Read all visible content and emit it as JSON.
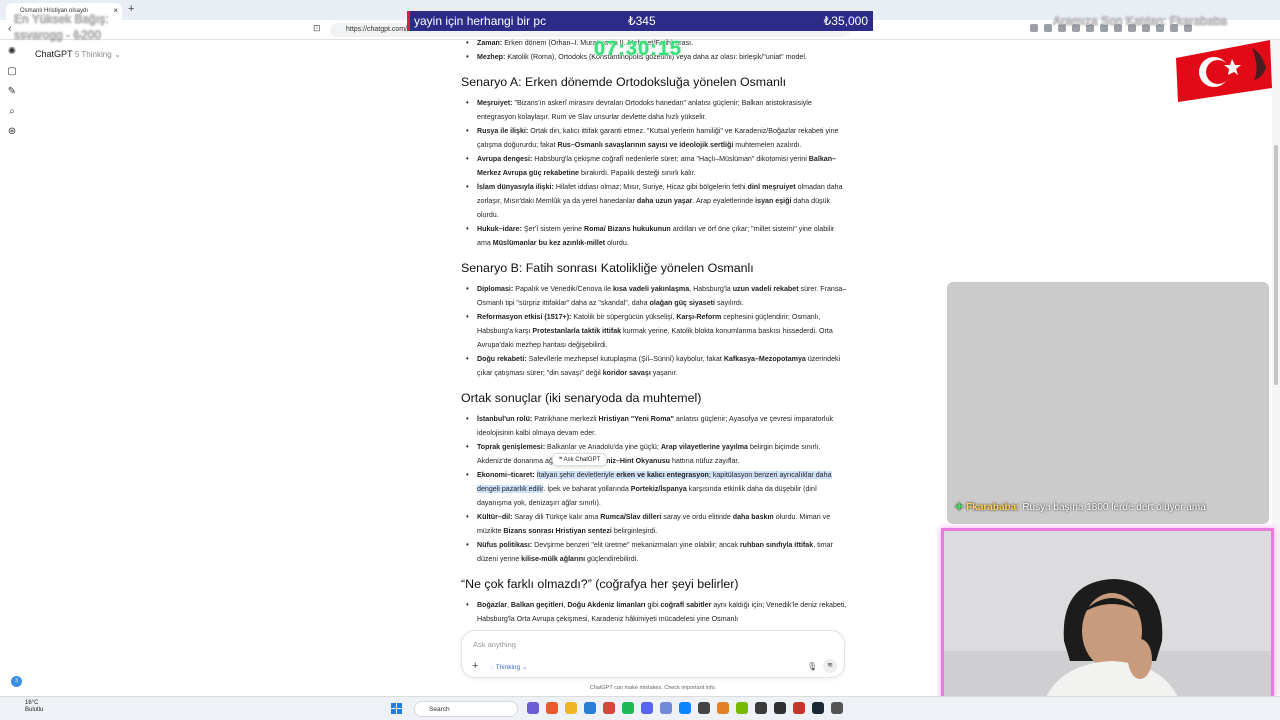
{
  "browser": {
    "tab_title": "Osmanlı Hristiyan olsaydı",
    "tab_close": "×",
    "new_tab": "+",
    "url": "https://chatgpt.com/c/6820f375-07fc-8010-8120-5553bb3bc550"
  },
  "app": {
    "model_name": "ChatGPT",
    "model_suffix": "5 Thinking"
  },
  "content": {
    "top_lines": [
      {
        "b": "Zaman:",
        "t": " Erken dönem (Orhan–I. Murat ya da II. Mehmet/Fatih) arası."
      },
      {
        "b": "Mezhep:",
        "t": " Katolik (Roma), Ortodoks (Konstantinopolis gözetimi) veya daha az olası: birleşik/\"uniat\" model."
      }
    ],
    "sections": [
      {
        "title": "Senaryo A: Erken dönemde Ortodoksluğa yönelen Osmanlı",
        "items": [
          [
            {
              "b": "Meşruiyet:"
            },
            {
              "t": " \"Bizans'ın askerî mirasını devralan Ortodoks hanedan\" anlatısı güçlenir; Balkan aristokrasisiyle entegrasyon kolaylaşır. Rum ve Slav unsurlar devlette daha hızlı yükselir."
            }
          ],
          [
            {
              "b": "Rusya ile ilişki:"
            },
            {
              "t": " Ortak din, kalıcı ittifak garanti etmez. \"Kutsal yerlerin hamiliği\" ve Karadeniz/Boğazlar rekabeti yine çatışma doğururdu; fakat "
            },
            {
              "b": "Rus–Osmanlı savaşlarının sayısı ve ideolojik sertliği"
            },
            {
              "t": " muhtemelen azalırdı."
            }
          ],
          [
            {
              "b": "Avrupa dengesi:"
            },
            {
              "t": " Habsburg'la çekişme coğrafî nedenlerle sürer; ama \"Haçlı–Müslüman\" dikotomisi yerini "
            },
            {
              "b": "Balkan–Merkez Avrupa güç rekabetine"
            },
            {
              "t": " bırakırdı. Papalık desteği sınırlı kalır."
            }
          ],
          [
            {
              "b": "İslam dünyasıyla ilişki:"
            },
            {
              "t": " Hilafet iddiası olmaz; Mısır, Suriye, Hicaz gibi bölgelerin fethi "
            },
            {
              "b": "dinî meşruiyet"
            },
            {
              "t": " olmadan daha zorlaşır, Mısır'daki Memlûk ya da yerel hanedanlar "
            },
            {
              "b": "daha uzun yaşar"
            },
            {
              "t": ". Arap eyaletlerinde "
            },
            {
              "b": "isyan eşiği"
            },
            {
              "t": " daha düşük olurdu."
            }
          ],
          [
            {
              "b": "Hukuk–idare:"
            },
            {
              "t": " Şer'î sistem yerine "
            },
            {
              "b": "Roma/ Bizans hukukunun"
            },
            {
              "t": " ardılları ve örf öne çıkar; \"millet sistemi\" yine olabilir ama "
            },
            {
              "b": "Müslümanlar bu kez azınlık-millet"
            },
            {
              "t": " olurdu."
            }
          ]
        ]
      },
      {
        "title": "Senaryo B: Fatih sonrası Katolikliğe yönelen Osmanlı",
        "items": [
          [
            {
              "b": "Diplomasi:"
            },
            {
              "t": " Papalık ve Venedik/Cenova ile "
            },
            {
              "b": "kısa vadeli yakınlaşma"
            },
            {
              "t": ", Habsburg'la "
            },
            {
              "b": "uzun vadeli rekabet"
            },
            {
              "t": " sürer. Fransa–Osmanlı tipi \"sürpriz ittifaklar\" daha az \"skandal\", daha "
            },
            {
              "b": "olağan güç siyaseti"
            },
            {
              "t": " sayılırdı."
            }
          ],
          [
            {
              "b": "Reformasyon etkisi (1517+):"
            },
            {
              "t": " Katolik bir süpergücün yükselişi, "
            },
            {
              "b": "Karşı-Reform"
            },
            {
              "t": " cephesini güçlendirir; Osmanlı, Habsburg'a karşı "
            },
            {
              "b": "Protestanlarla taktik ittifak"
            },
            {
              "t": " kurmak yerine, Katolik blokta konumlanma baskısı hissederdi. Orta Avrupa'daki mezhep haritası değişebilirdi."
            }
          ],
          [
            {
              "b": "Doğu rekabeti:"
            },
            {
              "t": " Safevîlerle mezhepsel kutuplaşma (Şiî–Sünnî) kaybolur, fakat "
            },
            {
              "b": "Kafkasya–Mezopotamya"
            },
            {
              "t": " üzerindeki çıkar çatışması sürer; \"din savaşı\" değil "
            },
            {
              "b": "koridor savaşı"
            },
            {
              "t": " yaşanır."
            }
          ]
        ]
      },
      {
        "title": "Ortak sonuçlar (iki senaryoda da muhtemel)",
        "items": [
          [
            {
              "b": "İstanbul'un rolü:"
            },
            {
              "t": " Patrikhane merkezli "
            },
            {
              "b": "Hristiyan \"Yeni Roma\""
            },
            {
              "t": " anlatısı güçlenir; Ayasofya ve çevresi imparatorluk ideolojisinin kalbi olmaya devam eder."
            }
          ],
          [
            {
              "b": "Toprak genişlemesi:"
            },
            {
              "t": " Balkanlar ve Anadolu'da yine güçlü; "
            },
            {
              "b": "Arap vilayetlerine yayılma"
            },
            {
              "t": " belirgin biçimde sınırlı. Akdeniz'de donanma ağırlığı sürer; "
            },
            {
              "b": "Akdeniz–Hint Okyanusu"
            },
            {
              "t": " hattına nüfuz zayıflar."
            }
          ],
          [
            {
              "b": "Ekonomi–ticaret:"
            },
            {
              "t": " "
            },
            {
              "h": "İtalyan şehir devletleriyle "
            },
            {
              "hb": "erken ve kalıcı entegrasyon"
            },
            {
              "h": "; kapitülasyon benzeri ayrıcalıklar daha dengeli pazarlık edilir"
            },
            {
              "t": ". İpek ve baharat yollarında "
            },
            {
              "b": "Portekiz/İspanya"
            },
            {
              "t": " karşısında etkinlik daha da düşebilir (dinî dayanışma yok, denizaşırı ağlar sınırlı)."
            }
          ],
          [
            {
              "b": "Kültür–dil:"
            },
            {
              "t": " Saray dili Türkçe kalır ama "
            },
            {
              "b": "Rumca/Slav dilleri"
            },
            {
              "t": " saray ve ordu elitinde "
            },
            {
              "b": "daha baskın"
            },
            {
              "t": " olurdu. Mimari ve müzikte "
            },
            {
              "b": "Bizans sonrası Hristiyan sentezi"
            },
            {
              "t": " belirginleşirdi."
            }
          ],
          [
            {
              "b": "Nüfus politikası:"
            },
            {
              "t": " Devşirme benzeri \"elit üretme\" mekanizmaları yine olabilir; ancak "
            },
            {
              "b": "ruhban sınıfıyla ittifak"
            },
            {
              "t": ", timar düzeni yerine "
            },
            {
              "b": "kilise-mülk ağlarını"
            },
            {
              "t": " güçlendirebilirdi."
            }
          ]
        ]
      },
      {
        "title": "“Ne çok farklı olmazdı?” (coğrafya her şeyi belirler)",
        "items": [
          [
            {
              "b": "Boğazlar"
            },
            {
              "t": ", "
            },
            {
              "b": "Balkan geçitleri"
            },
            {
              "t": ", "
            },
            {
              "b": "Doğu Akdeniz limanları"
            },
            {
              "t": " gibi "
            },
            {
              "b": "coğrafî sabitler"
            },
            {
              "t": " aynı kaldığı için; Venedik'le deniz rekabeti, Habsburg'la Orta Avrupa çekişmesi, Karadeniz hâkimiyeti mücadelesi yine Osmanlı"
            }
          ]
        ]
      }
    ],
    "ask_tooltip": "Ask ChatGPT"
  },
  "composer": {
    "placeholder": "Ask anything",
    "plus": "+",
    "mode": "Thinking",
    "disclaimer": "ChatGPT can make mistakes. Check important info."
  },
  "overlays": {
    "banner_text": "yayin için herhangi bir pc",
    "banner_amount_left": "₺345",
    "banner_amount_right": "₺35,000",
    "timer": "07:30:15",
    "top_donor_line1": "En Yüksek Bağış:",
    "top_donor_line2": "ssvarogg - ₺200",
    "latest_follower": "Aramıza Son Katılan: Fkarababa",
    "chat_plus": "✚",
    "chat_user": "Fkarababa:",
    "chat_text": " Rusya başına 1800 lerde dert oluyor ama"
  },
  "taskbar": {
    "temperature": "16°C",
    "weather": "Bulutlu",
    "search": "Search",
    "notif_count": "3"
  },
  "colors": {
    "banner_bg": "#2c2c88",
    "timer": "#38e07b",
    "highlight": "#cfe2fb",
    "webcam_border": "#e97bdf",
    "flag_red": "#e30a17"
  }
}
